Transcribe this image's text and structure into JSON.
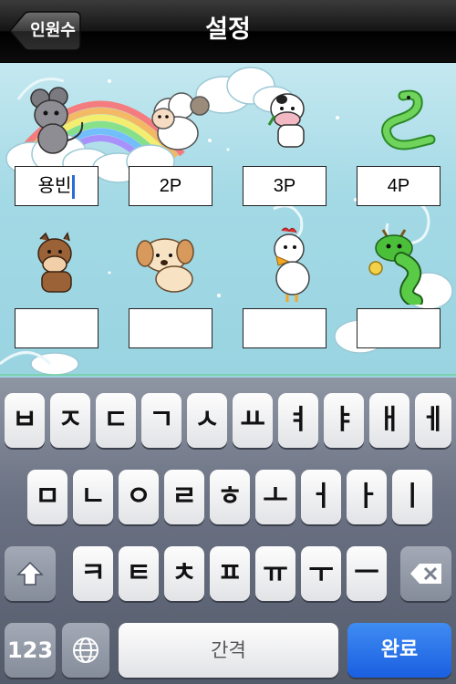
{
  "navbar": {
    "title": "설정",
    "back_label": "인원수"
  },
  "players": [
    {
      "animal": "rat",
      "name": "용빈",
      "editing": true
    },
    {
      "animal": "sheep",
      "name": "2P"
    },
    {
      "animal": "cow",
      "name": "3P"
    },
    {
      "animal": "snake",
      "name": "4P"
    },
    {
      "animal": "horse",
      "name": ""
    },
    {
      "animal": "dog",
      "name": ""
    },
    {
      "animal": "rooster",
      "name": ""
    },
    {
      "animal": "dragon",
      "name": ""
    }
  ],
  "keyboard": {
    "row1": [
      "ㅂ",
      "ㅈ",
      "ㄷ",
      "ㄱ",
      "ㅅ",
      "ㅛ",
      "ㅕ",
      "ㅑ",
      "ㅐ",
      "ㅔ"
    ],
    "row2": [
      "ㅁ",
      "ㄴ",
      "ㅇ",
      "ㄹ",
      "ㅎ",
      "ㅗ",
      "ㅓ",
      "ㅏ",
      "ㅣ"
    ],
    "row3": [
      "ㅋ",
      "ㅌ",
      "ㅊ",
      "ㅍ",
      "ㅠ",
      "ㅜ",
      "ㅡ"
    ],
    "numbers_label": "123",
    "space_label": "간격",
    "done_label": "완료",
    "shift_icon": "shift-arrow-icon",
    "globe_icon": "globe-icon",
    "delete_icon": "backspace-icon"
  },
  "colors": {
    "caret": "#2a6dd9",
    "done_key": "#1a5fe0"
  }
}
